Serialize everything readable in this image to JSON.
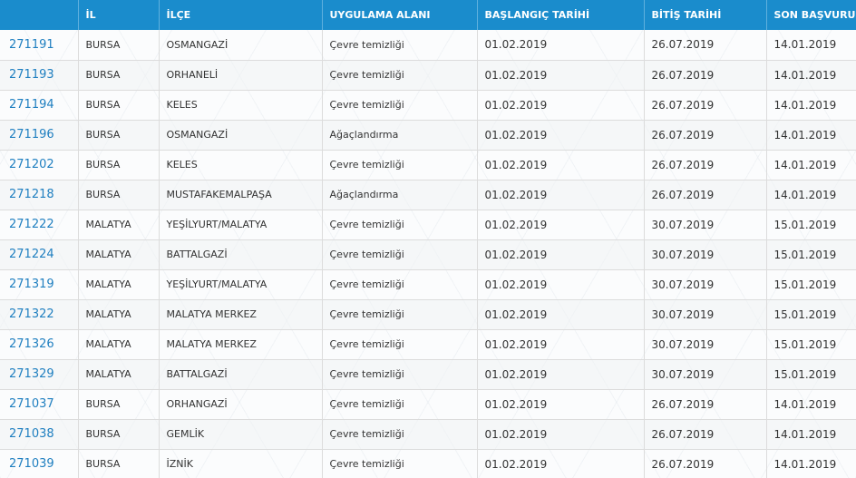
{
  "table": {
    "headers": [
      "",
      "İL",
      "İLÇE",
      "UYGULAMA ALANI",
      "BAŞLANGIÇ TARİHİ",
      "BİTİŞ TARİHİ",
      "SON BAŞVURU"
    ],
    "rows": [
      [
        "271191",
        "BURSA",
        "OSMANGAZİ",
        "Çevre temizliği",
        "01.02.2019",
        "26.07.2019",
        "14.01.2019"
      ],
      [
        "271193",
        "BURSA",
        "ORHANELİ",
        "Çevre temizliği",
        "01.02.2019",
        "26.07.2019",
        "14.01.2019"
      ],
      [
        "271194",
        "BURSA",
        "KELES",
        "Çevre temizliği",
        "01.02.2019",
        "26.07.2019",
        "14.01.2019"
      ],
      [
        "271196",
        "BURSA",
        "OSMANGAZİ",
        "Ağaçlandırma",
        "01.02.2019",
        "26.07.2019",
        "14.01.2019"
      ],
      [
        "271202",
        "BURSA",
        "KELES",
        "Çevre temizliği",
        "01.02.2019",
        "26.07.2019",
        "14.01.2019"
      ],
      [
        "271218",
        "BURSA",
        "MUSTAFAKEMALPAŞA",
        "Ağaçlandırma",
        "01.02.2019",
        "26.07.2019",
        "14.01.2019"
      ],
      [
        "271222",
        "MALATYA",
        "YEŞİLYURT/MALATYA",
        "Çevre temizliği",
        "01.02.2019",
        "30.07.2019",
        "15.01.2019"
      ],
      [
        "271224",
        "MALATYA",
        "BATTALGAZİ",
        "Çevre temizliği",
        "01.02.2019",
        "30.07.2019",
        "15.01.2019"
      ],
      [
        "271319",
        "MALATYA",
        "YEŞİLYURT/MALATYA",
        "Çevre temizliği",
        "01.02.2019",
        "30.07.2019",
        "15.01.2019"
      ],
      [
        "271322",
        "MALATYA",
        "MALATYA MERKEZ",
        "Çevre temizliği",
        "01.02.2019",
        "30.07.2019",
        "15.01.2019"
      ],
      [
        "271326",
        "MALATYA",
        "MALATYA MERKEZ",
        "Çevre temizliği",
        "01.02.2019",
        "30.07.2019",
        "15.01.2019"
      ],
      [
        "271329",
        "MALATYA",
        "BATTALGAZİ",
        "Çevre temizliği",
        "01.02.2019",
        "30.07.2019",
        "15.01.2019"
      ],
      [
        "271037",
        "BURSA",
        "ORHANGAZİ",
        "Çevre temizliği",
        "01.02.2019",
        "26.07.2019",
        "14.01.2019"
      ],
      [
        "271038",
        "BURSA",
        "GEMLİK",
        "Çevre temizliği",
        "01.02.2019",
        "26.07.2019",
        "14.01.2019"
      ],
      [
        "271039",
        "BURSA",
        "İZNİK",
        "Çevre temizliği",
        "01.02.2019",
        "26.07.2019",
        "14.01.2019"
      ]
    ]
  },
  "colors": {
    "header_bg": "#1a8ccc",
    "header_text": "#ffffff",
    "link": "#1f7fc0"
  }
}
